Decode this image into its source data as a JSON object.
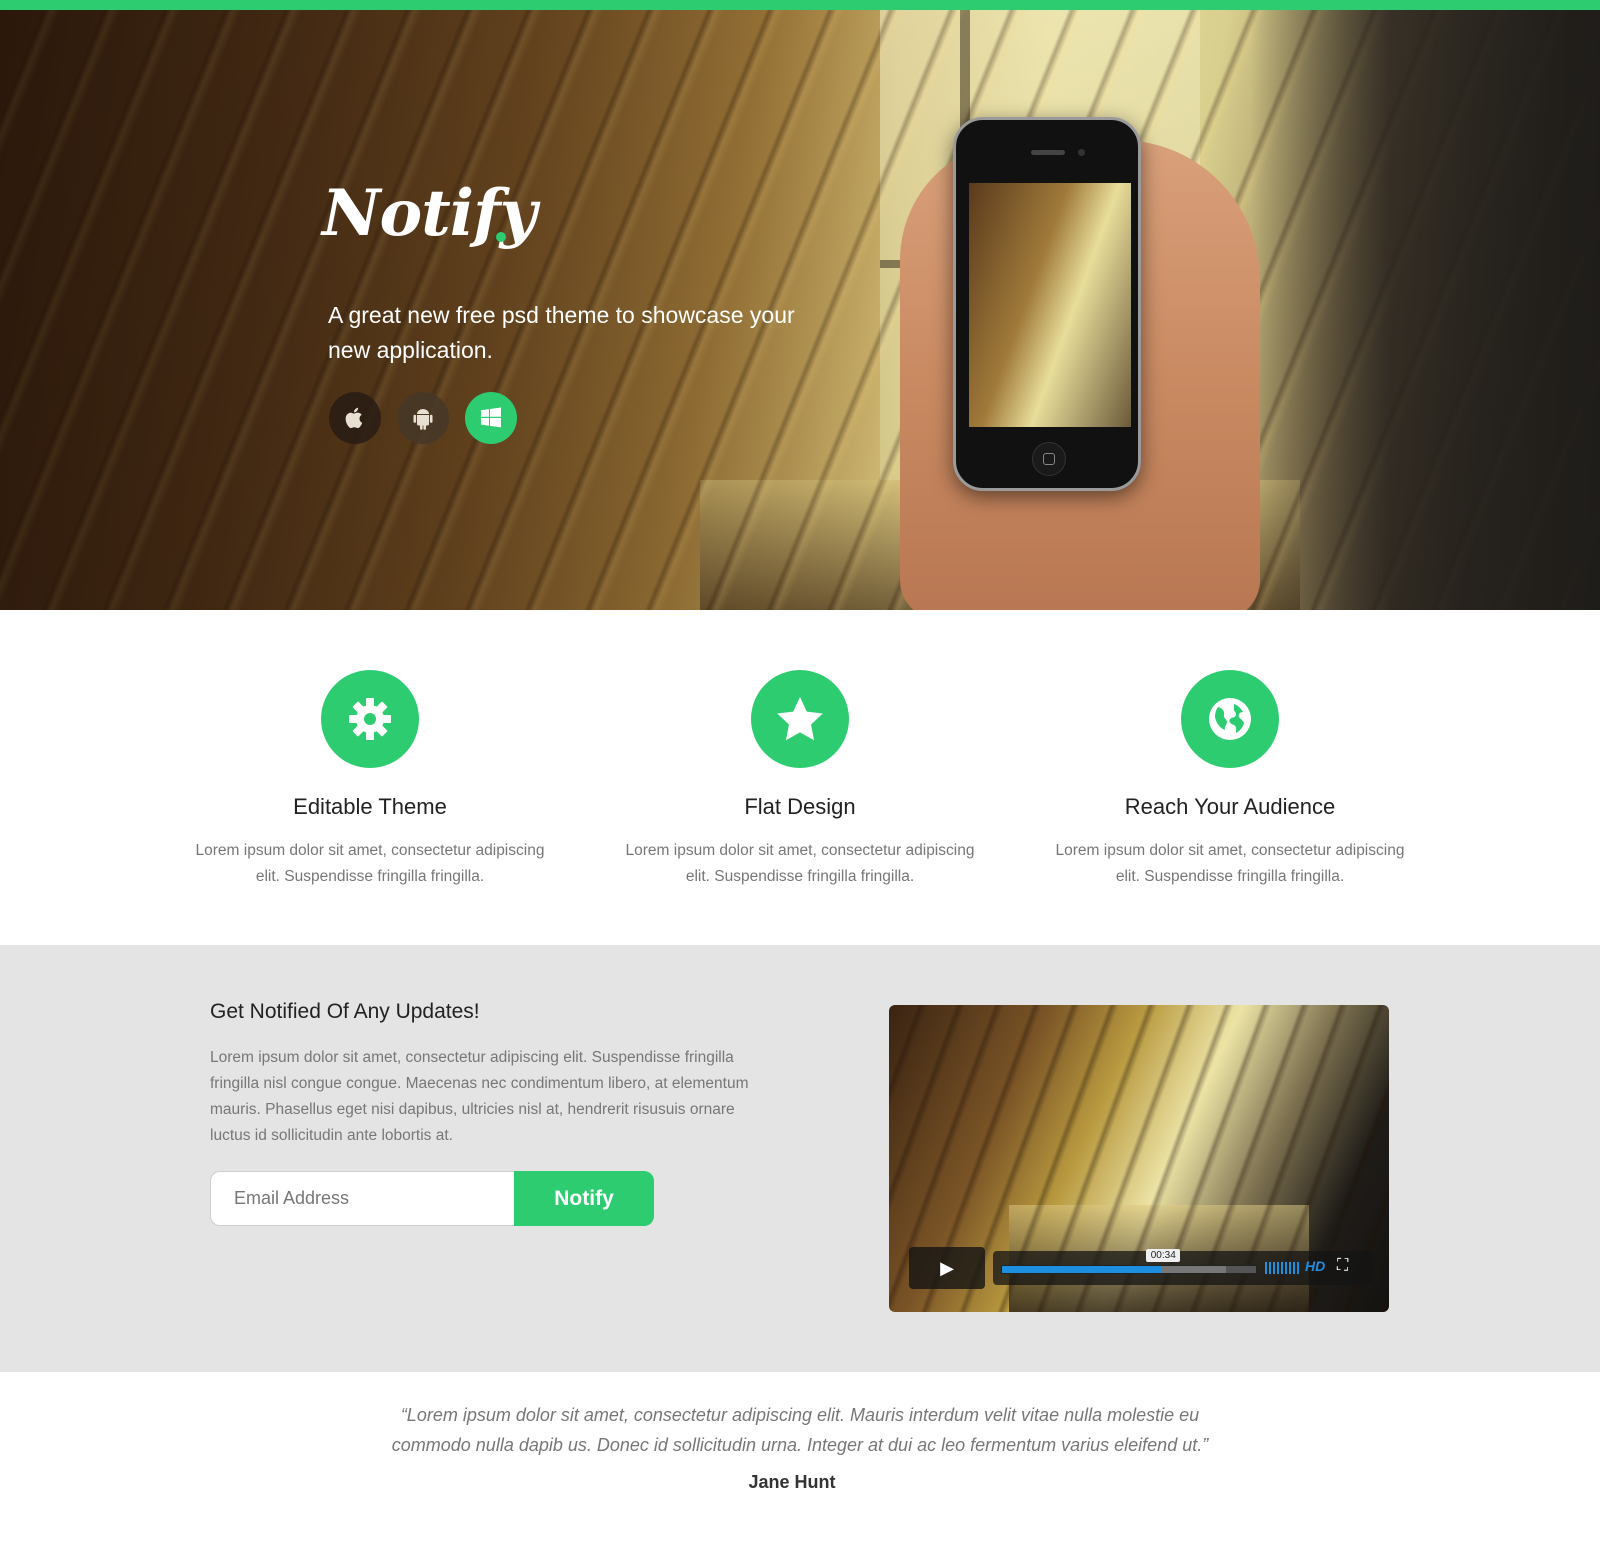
{
  "colors": {
    "accent": "#2ecc71",
    "video_progress": "#1e8fe0"
  },
  "hero": {
    "logo": "Notify",
    "tagline": "A great new free psd theme to showcase your new application.",
    "stores": [
      {
        "name": "Apple",
        "icon": "apple-icon"
      },
      {
        "name": "Android",
        "icon": "android-icon"
      },
      {
        "name": "Windows",
        "icon": "windows-icon"
      }
    ]
  },
  "features": [
    {
      "icon": "gear-icon",
      "title": "Editable Theme",
      "text": "Lorem ipsum dolor sit amet, consectetur adipiscing elit. Suspendisse fringilla fringilla."
    },
    {
      "icon": "star-icon",
      "title": "Flat Design",
      "text": "Lorem ipsum dolor sit amet, consectetur adipiscing elit. Suspendisse fringilla fringilla."
    },
    {
      "icon": "globe-icon",
      "title": "Reach Your Audience",
      "text": "Lorem ipsum dolor sit amet, consectetur adipiscing elit. Suspendisse fringilla fringilla."
    }
  ],
  "notify": {
    "title": "Get Notified Of Any Updates!",
    "text": "Lorem ipsum dolor sit amet, consectetur adipiscing elit. Suspendisse fringilla fringilla nisl congue congue. Maecenas nec condimentum libero, at elementum mauris. Phasellus eget nisi dapibus, ultricies nisl at, hendrerit risusuis ornare luctus id sollicitudin ante lobortis at.",
    "email_placeholder": "Email Address",
    "button_label": "Notify"
  },
  "video": {
    "time": "00:34",
    "hd_label": "HD",
    "progress_fraction": 0.63,
    "buffered_fraction": 0.88
  },
  "testimonial": {
    "quote": "“Lorem ipsum dolor sit amet, consectetur adipiscing elit. Mauris interdum velit vitae nulla molestie eu commodo nulla dapib us. Donec id sollicitudin urna. Integer at dui ac leo fermentum varius eleifend ut.”",
    "author": "Jane Hunt"
  }
}
